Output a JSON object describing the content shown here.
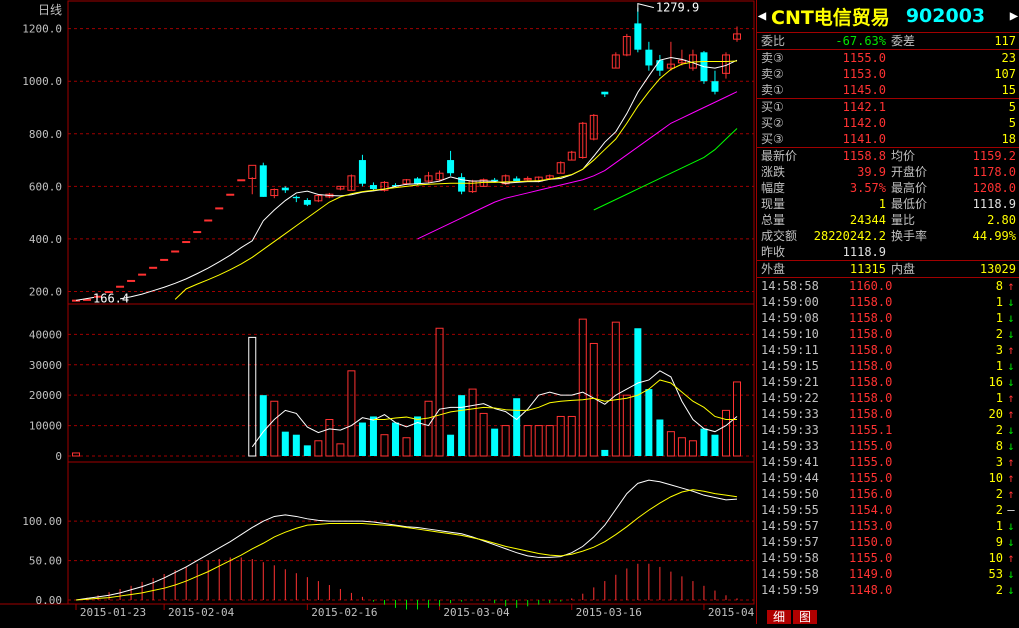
{
  "chart": {
    "period_label": "日线",
    "y_ticks": [
      "1200.0",
      "1000.0",
      "800.0",
      "600.0",
      "400.0",
      "200.0"
    ],
    "high_label": "1279.9",
    "low_label": "166.4",
    "vol_ticks": [
      "40000",
      "30000",
      "20000",
      "10000",
      "0"
    ],
    "macd_ticks": [
      "100.00",
      "50.00",
      "0.00"
    ],
    "dates": [
      "2015-01-23",
      "2015-02-04",
      "2015-02-16",
      "2015-03-04",
      "2015-03-16",
      "2015-04-01"
    ],
    "colors": {
      "up": "#ff3232",
      "down": "#00ffff",
      "grid": "#a00000",
      "ma5": "#ffffff",
      "ma10": "#ffff00",
      "ma20": "#ff00ff",
      "ma30": "#00ff00"
    }
  },
  "chart_data": {
    "type": "candlestick",
    "y_price_range": [
      160,
      1290
    ],
    "y_volume_range": [
      0,
      48000
    ],
    "y_macd_range": [
      0,
      170
    ],
    "candles": [
      [
        167,
        167,
        166,
        167,
        1000
      ],
      [
        170,
        170,
        170,
        170,
        0
      ],
      [
        182,
        182,
        182,
        182,
        0
      ],
      [
        200,
        200,
        200,
        200,
        0
      ],
      [
        220,
        220,
        220,
        220,
        0
      ],
      [
        242,
        242,
        242,
        242,
        0
      ],
      [
        266,
        266,
        266,
        266,
        0
      ],
      [
        292,
        292,
        292,
        292,
        0
      ],
      [
        322,
        322,
        322,
        322,
        0
      ],
      [
        354,
        354,
        354,
        354,
        0
      ],
      [
        390,
        390,
        390,
        390,
        0
      ],
      [
        428,
        428,
        428,
        428,
        0
      ],
      [
        472,
        472,
        472,
        472,
        0
      ],
      [
        518,
        518,
        518,
        518,
        0
      ],
      [
        570,
        570,
        570,
        570,
        0
      ],
      [
        625,
        625,
        625,
        625,
        0
      ],
      [
        630,
        680,
        635,
        570,
        39000
      ],
      [
        680,
        560,
        690,
        560,
        20000
      ],
      [
        565,
        588,
        592,
        555,
        18000
      ],
      [
        595,
        585,
        600,
        575,
        8000
      ],
      [
        560,
        555,
        565,
        540,
        7000
      ],
      [
        548,
        530,
        555,
        525,
        3500
      ],
      [
        545,
        565,
        568,
        540,
        5000
      ],
      [
        560,
        570,
        575,
        555,
        12000
      ],
      [
        590,
        600,
        600,
        585,
        4000
      ],
      [
        585,
        640,
        645,
        585,
        28000
      ],
      [
        700,
        610,
        720,
        600,
        11000
      ],
      [
        605,
        590,
        615,
        585,
        13000
      ],
      [
        585,
        615,
        620,
        580,
        7000
      ],
      [
        605,
        600,
        612,
        598,
        11000
      ],
      [
        610,
        625,
        628,
        605,
        6000
      ],
      [
        630,
        610,
        635,
        605,
        13000
      ],
      [
        620,
        640,
        655,
        612,
        18000
      ],
      [
        625,
        650,
        660,
        620,
        42000
      ],
      [
        700,
        650,
        735,
        640,
        7000
      ],
      [
        635,
        580,
        650,
        570,
        20000
      ],
      [
        580,
        620,
        625,
        575,
        22000
      ],
      [
        600,
        625,
        630,
        598,
        14000
      ],
      [
        625,
        620,
        632,
        615,
        9000
      ],
      [
        610,
        640,
        645,
        605,
        10000
      ],
      [
        630,
        620,
        638,
        615,
        19000
      ],
      [
        625,
        630,
        638,
        620,
        10000
      ],
      [
        620,
        635,
        638,
        615,
        10000
      ],
      [
        630,
        640,
        645,
        625,
        10000
      ],
      [
        650,
        690,
        695,
        650,
        13000
      ],
      [
        700,
        730,
        735,
        700,
        13000
      ],
      [
        710,
        840,
        845,
        705,
        45000
      ],
      [
        780,
        870,
        875,
        775,
        37000
      ],
      [
        960,
        950,
        960,
        940,
        2000
      ],
      [
        1050,
        1100,
        1110,
        1050,
        44000
      ],
      [
        1100,
        1170,
        1180,
        1095,
        20000
      ],
      [
        1220,
        1120,
        1280,
        1110,
        42000
      ],
      [
        1120,
        1060,
        1150,
        1040,
        22000
      ],
      [
        1080,
        1040,
        1100,
        1020,
        12000
      ],
      [
        1050,
        1065,
        1150,
        1040,
        8000
      ],
      [
        1070,
        1080,
        1120,
        1060,
        6000
      ],
      [
        1050,
        1100,
        1120,
        1040,
        5000
      ],
      [
        1110,
        1000,
        1115,
        990,
        9000
      ],
      [
        1000,
        960,
        1040,
        950,
        7000
      ],
      [
        1030,
        1100,
        1110,
        1010,
        15000
      ],
      [
        1160,
        1180,
        1208,
        1150,
        24344
      ]
    ],
    "ma5": [
      null,
      null,
      null,
      null,
      172,
      180,
      190,
      203,
      216,
      231,
      248,
      268,
      289,
      313,
      338,
      367,
      393,
      469,
      510,
      546,
      575,
      582,
      569,
      565,
      564,
      568,
      578,
      583,
      589,
      600,
      608,
      610,
      613,
      620,
      636,
      625,
      620,
      621,
      619,
      612,
      615,
      618,
      618,
      627,
      630,
      644,
      665,
      715,
      768,
      808,
      877,
      958,
      1020,
      1080,
      1090,
      1083,
      1070,
      1055,
      1050,
      1060,
      1080
    ],
    "ma10": [
      null,
      null,
      null,
      null,
      null,
      null,
      null,
      null,
      null,
      170,
      210,
      228,
      245,
      263,
      283,
      305,
      330,
      360,
      390,
      420,
      450,
      480,
      510,
      540,
      560,
      572,
      580,
      585,
      590,
      595,
      600,
      605,
      608,
      610,
      612,
      612,
      612,
      615,
      615,
      617,
      618,
      620,
      622,
      627,
      635,
      645,
      665,
      700,
      740,
      780,
      840,
      905,
      960,
      1010,
      1045,
      1065,
      1073,
      1075,
      1075,
      1075,
      1077
    ],
    "ma20": [
      null,
      null,
      null,
      null,
      null,
      null,
      null,
      null,
      null,
      null,
      null,
      null,
      null,
      null,
      null,
      null,
      null,
      null,
      null,
      null,
      null,
      null,
      null,
      null,
      null,
      null,
      null,
      null,
      null,
      null,
      null,
      400,
      420,
      440,
      460,
      480,
      500,
      520,
      540,
      555,
      565,
      575,
      585,
      595,
      605,
      615,
      625,
      640,
      660,
      690,
      720,
      750,
      780,
      810,
      840,
      860,
      880,
      900,
      920,
      940,
      960
    ],
    "ma30": [
      null,
      null,
      null,
      null,
      null,
      null,
      null,
      null,
      null,
      null,
      null,
      null,
      null,
      null,
      null,
      null,
      null,
      null,
      null,
      null,
      null,
      null,
      null,
      null,
      null,
      null,
      null,
      null,
      null,
      null,
      null,
      null,
      null,
      null,
      null,
      null,
      null,
      null,
      null,
      null,
      null,
      null,
      null,
      null,
      null,
      null,
      null,
      510,
      530,
      550,
      570,
      590,
      610,
      630,
      650,
      670,
      690,
      710,
      740,
      780,
      820
    ],
    "vol_ma1": [
      null,
      null,
      null,
      null,
      null,
      null,
      null,
      null,
      null,
      null,
      null,
      null,
      null,
      null,
      null,
      null,
      3000,
      8000,
      12000,
      15000,
      14000,
      9500,
      7700,
      8900,
      8500,
      10000,
      12600,
      11800,
      13600,
      11000,
      9600,
      11000,
      10000,
      15400,
      16000,
      16000,
      16600,
      17200,
      15600,
      14600,
      12000,
      15400,
      20000,
      21000,
      20000,
      20000,
      21000,
      19000,
      17000,
      20000,
      22000,
      24000,
      25000,
      28000,
      26000,
      18000,
      12000,
      9000,
      8000,
      10000,
      13000
    ],
    "vol_ma2": [
      null,
      null,
      null,
      null,
      null,
      null,
      null,
      null,
      null,
      null,
      null,
      null,
      null,
      null,
      null,
      null,
      null,
      null,
      null,
      null,
      null,
      null,
      null,
      null,
      null,
      null,
      null,
      12000,
      12000,
      12500,
      12800,
      12000,
      12500,
      13500,
      14500,
      15000,
      15500,
      16000,
      15800,
      15200,
      15000,
      15000,
      16000,
      17500,
      18000,
      18300,
      18500,
      19000,
      18000,
      18500,
      19000,
      20000,
      22000,
      25000,
      24000,
      21000,
      18000,
      16000,
      13000,
      12000,
      12000
    ],
    "macd_hist": [
      0,
      3,
      6,
      10,
      14,
      18,
      23,
      28,
      33,
      38,
      42,
      46,
      50,
      52,
      54,
      54,
      52,
      48,
      44,
      39,
      34,
      29,
      24,
      19,
      14,
      9,
      4,
      -2,
      -6,
      -10,
      -12,
      -12,
      -10,
      -8,
      -4,
      -2,
      0,
      -1,
      -4,
      -8,
      -10,
      -8,
      -6,
      -4,
      -2,
      2,
      8,
      16,
      24,
      32,
      40,
      46,
      46,
      42,
      36,
      30,
      24,
      18,
      12,
      6,
      2
    ],
    "macd_dif": [
      0,
      2,
      4,
      6,
      9,
      13,
      17,
      22,
      28,
      35,
      42,
      50,
      58,
      66,
      74,
      83,
      92,
      100,
      106,
      108,
      106,
      103,
      101,
      100,
      100,
      100,
      100,
      99,
      97,
      95,
      93,
      92,
      90,
      88,
      86,
      84,
      80,
      75,
      70,
      65,
      60,
      56,
      54,
      54,
      55,
      60,
      68,
      80,
      95,
      115,
      135,
      148,
      152,
      150,
      146,
      142,
      138,
      133,
      130,
      127,
      128
    ],
    "macd_dea": [
      0,
      1,
      2,
      3,
      5,
      7,
      9,
      12,
      15,
      19,
      24,
      30,
      36,
      43,
      50,
      57,
      65,
      72,
      80,
      86,
      91,
      95,
      96,
      97,
      97,
      97,
      97,
      96,
      95,
      94,
      92,
      90,
      88,
      86,
      84,
      82,
      79,
      76,
      72,
      68,
      65,
      62,
      59,
      57,
      56,
      58,
      62,
      67,
      74,
      83,
      93,
      104,
      114,
      123,
      131,
      137,
      140,
      138,
      135,
      133,
      131
    ]
  },
  "quote": {
    "name": "CNT电信贸易",
    "code": "902003",
    "weibi_label": "委比",
    "weibi": "-67.63%",
    "weicha_label": "委差",
    "weicha": "117",
    "asks": [
      {
        "label": "卖③",
        "price": "1155.0",
        "vol": "23"
      },
      {
        "label": "卖②",
        "price": "1153.0",
        "vol": "107"
      },
      {
        "label": "卖①",
        "price": "1145.0",
        "vol": "15"
      }
    ],
    "bids": [
      {
        "label": "买①",
        "price": "1142.1",
        "vol": "5"
      },
      {
        "label": "买②",
        "price": "1142.0",
        "vol": "5"
      },
      {
        "label": "买③",
        "price": "1141.0",
        "vol": "18"
      }
    ],
    "stats": [
      {
        "l1": "最新价",
        "v1": "1158.8",
        "c1": "red",
        "l2": "均价",
        "v2": "1159.2",
        "c2": "red"
      },
      {
        "l1": "涨跌",
        "v1": "39.9",
        "c1": "red",
        "l2": "开盘价",
        "v2": "1178.0",
        "c2": "red"
      },
      {
        "l1": "幅度",
        "v1": "3.57%",
        "c1": "red",
        "l2": "最高价",
        "v2": "1208.0",
        "c2": "red"
      },
      {
        "l1": "现量",
        "v1": "1",
        "c1": "yel",
        "l2": "最低价",
        "v2": "1118.9",
        "c2": "wht"
      },
      {
        "l1": "总量",
        "v1": "24344",
        "c1": "yel",
        "l2": "量比",
        "v2": "2.80",
        "c2": "yel"
      },
      {
        "l1": "成交额",
        "v1": "28220242.2",
        "c1": "yel",
        "l2": "换手率",
        "v2": "44.99%",
        "c2": "yel"
      },
      {
        "l1": "昨收",
        "v1": "1118.9",
        "c1": "wht",
        "l2": "",
        "v2": "",
        "c2": "wht"
      }
    ],
    "waipan_label": "外盘",
    "waipan": "11315",
    "neipan_label": "内盘",
    "neipan": "13029",
    "ticks": [
      {
        "t": "14:58:58",
        "p": "1160.0",
        "v": "8",
        "d": "up"
      },
      {
        "t": "14:59:00",
        "p": "1158.0",
        "v": "1",
        "d": "down"
      },
      {
        "t": "14:59:08",
        "p": "1158.0",
        "v": "1",
        "d": "down"
      },
      {
        "t": "14:59:10",
        "p": "1158.0",
        "v": "2",
        "d": "down"
      },
      {
        "t": "14:59:11",
        "p": "1158.0",
        "v": "3",
        "d": "up"
      },
      {
        "t": "14:59:15",
        "p": "1158.0",
        "v": "1",
        "d": "down"
      },
      {
        "t": "14:59:21",
        "p": "1158.0",
        "v": "16",
        "d": "down"
      },
      {
        "t": "14:59:22",
        "p": "1158.0",
        "v": "1",
        "d": "up"
      },
      {
        "t": "14:59:33",
        "p": "1158.0",
        "v": "20",
        "d": "up"
      },
      {
        "t": "14:59:33",
        "p": "1155.1",
        "v": "2",
        "d": "down"
      },
      {
        "t": "14:59:33",
        "p": "1155.0",
        "v": "8",
        "d": "down"
      },
      {
        "t": "14:59:41",
        "p": "1155.0",
        "v": "3",
        "d": "up"
      },
      {
        "t": "14:59:44",
        "p": "1155.0",
        "v": "10",
        "d": "up"
      },
      {
        "t": "14:59:50",
        "p": "1156.0",
        "v": "2",
        "d": "up"
      },
      {
        "t": "14:59:55",
        "p": "1154.0",
        "v": "2",
        "d": "flat"
      },
      {
        "t": "14:59:57",
        "p": "1153.0",
        "v": "1",
        "d": "down"
      },
      {
        "t": "14:59:57",
        "p": "1150.0",
        "v": "9",
        "d": "down"
      },
      {
        "t": "14:59:58",
        "p": "1155.0",
        "v": "10",
        "d": "up"
      },
      {
        "t": "14:59:58",
        "p": "1149.0",
        "v": "53",
        "d": "down"
      },
      {
        "t": "14:59:59",
        "p": "1148.0",
        "v": "2",
        "d": "down"
      }
    ],
    "tab1": "细",
    "tab2": "图",
    "arrow_left": "◀",
    "arrow_right": "▶"
  }
}
